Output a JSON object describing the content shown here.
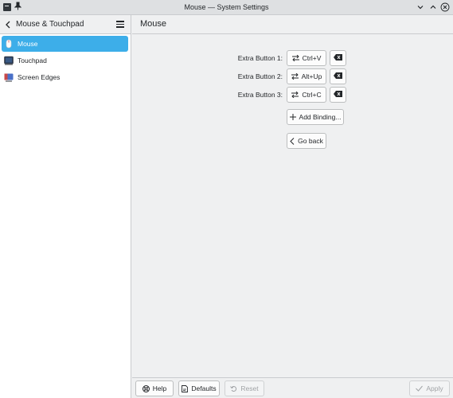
{
  "window": {
    "title": "Mouse — System Settings"
  },
  "sidebar": {
    "header_title": "Mouse & Touchpad",
    "items": [
      {
        "label": "Mouse",
        "icon": "mouse-icon",
        "active": true
      },
      {
        "label": "Touchpad",
        "icon": "touchpad-icon",
        "active": false
      },
      {
        "label": "Screen Edges",
        "icon": "screen-edges-icon",
        "active": false
      }
    ]
  },
  "main": {
    "title": "Mouse",
    "bindings": [
      {
        "label": "Extra Button 1:",
        "key": "Ctrl+V"
      },
      {
        "label": "Extra Button 2:",
        "key": "Alt+Up"
      },
      {
        "label": "Extra Button 3:",
        "key": "Ctrl+C"
      }
    ],
    "add_binding_label": "Add Binding...",
    "go_back_label": "Go back"
  },
  "footer": {
    "help_label": "Help",
    "defaults_label": "Defaults",
    "reset_label": "Reset",
    "apply_label": "Apply"
  },
  "colors": {
    "accent": "#3daee9",
    "background": "#eff0f1",
    "text": "#232629"
  }
}
